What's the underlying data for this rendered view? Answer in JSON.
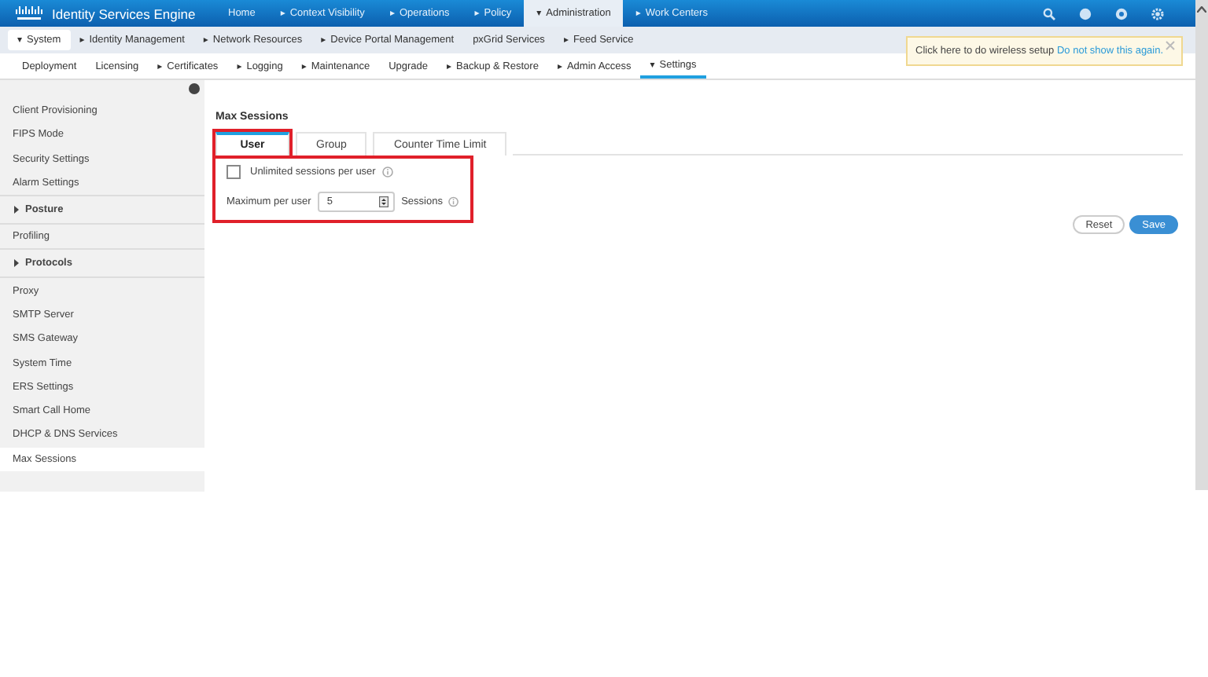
{
  "app": {
    "title": "Identity Services Engine"
  },
  "main_nav": [
    {
      "label": "Home",
      "selected": false
    },
    {
      "label": "Context Visibility",
      "caret": "▸",
      "selected": false
    },
    {
      "label": "Operations",
      "caret": "▸",
      "selected": false
    },
    {
      "label": "Policy",
      "caret": "▸",
      "selected": false
    },
    {
      "label": "Administration",
      "caret": "▾",
      "selected": true
    },
    {
      "label": "Work Centers",
      "caret": "▸",
      "selected": false
    }
  ],
  "sub_nav": [
    {
      "label": "System",
      "caret": "▾",
      "selected": true
    },
    {
      "label": "Identity Management",
      "caret": "▸",
      "selected": false
    },
    {
      "label": "Network Resources",
      "caret": "▸",
      "selected": false
    },
    {
      "label": "Device Portal Management",
      "caret": "▸",
      "selected": false
    },
    {
      "label": "pxGrid Services",
      "selected": false
    },
    {
      "label": "Feed Service",
      "caret": "▸",
      "selected": false
    }
  ],
  "third_nav": [
    {
      "label": "Deployment",
      "selected": false
    },
    {
      "label": "Licensing",
      "selected": false
    },
    {
      "label": "Certificates",
      "caret": "▸",
      "selected": false
    },
    {
      "label": "Logging",
      "caret": "▸",
      "selected": false
    },
    {
      "label": "Maintenance",
      "caret": "▸",
      "selected": false
    },
    {
      "label": "Upgrade",
      "selected": false
    },
    {
      "label": "Backup & Restore",
      "caret": "▸",
      "selected": false
    },
    {
      "label": "Admin Access",
      "caret": "▸",
      "selected": false
    },
    {
      "label": "Settings",
      "caret": "▾",
      "selected": true
    }
  ],
  "tooltip": {
    "text": "Click here to do wireless setup",
    "link": "Do not show this again."
  },
  "sidebar": {
    "items": [
      {
        "label": "Client Provisioning",
        "kind": "item",
        "selected": false
      },
      {
        "label": "FIPS Mode",
        "kind": "item",
        "selected": false
      },
      {
        "label": "Security Settings",
        "kind": "item",
        "selected": false
      },
      {
        "label": "Alarm Settings",
        "kind": "item",
        "selected": false
      },
      {
        "label": "Posture",
        "kind": "group",
        "selected": false
      },
      {
        "label": "Profiling",
        "kind": "item",
        "selected": false
      },
      {
        "label": "Protocols",
        "kind": "group",
        "selected": false
      },
      {
        "label": "Proxy",
        "kind": "item",
        "selected": false
      },
      {
        "label": "SMTP Server",
        "kind": "item",
        "selected": false
      },
      {
        "label": "SMS Gateway",
        "kind": "item",
        "selected": false
      },
      {
        "label": "System Time",
        "kind": "item",
        "selected": false
      },
      {
        "label": "ERS Settings",
        "kind": "item",
        "selected": false
      },
      {
        "label": "Smart Call Home",
        "kind": "item",
        "selected": false
      },
      {
        "label": "DHCP & DNS Services",
        "kind": "item",
        "selected": false
      },
      {
        "label": "Max Sessions",
        "kind": "item",
        "selected": true
      }
    ]
  },
  "content": {
    "title": "Max Sessions",
    "tabs": [
      {
        "label": "User",
        "selected": true,
        "highlighted": true
      },
      {
        "label": "Group",
        "selected": false,
        "highlighted": false
      },
      {
        "label": "Counter Time Limit",
        "selected": false,
        "highlighted": false
      }
    ],
    "form": {
      "highlighted": true,
      "unlimited": {
        "label": "Unlimited sessions per user",
        "checked": false
      },
      "maximum": {
        "label": "Maximum per user",
        "value": "5",
        "unit": "Sessions"
      }
    },
    "buttons": [
      {
        "label": "Reset",
        "kind": "secondary"
      },
      {
        "label": "Save",
        "kind": "primary"
      }
    ]
  }
}
